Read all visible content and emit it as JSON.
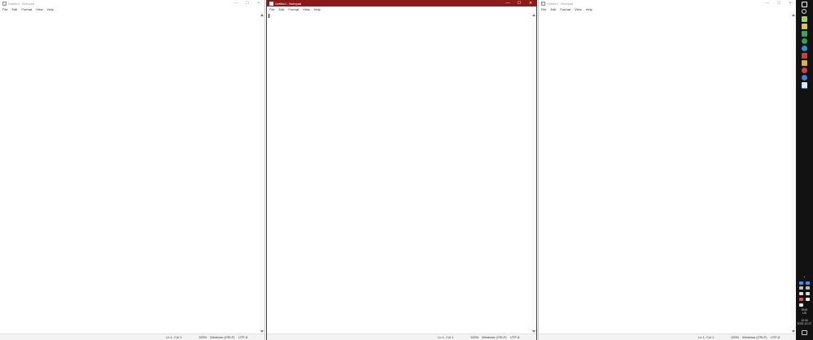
{
  "windows": [
    {
      "title": "Untitled - Notepad",
      "menu": [
        "File",
        "Edit",
        "Format",
        "View",
        "Help"
      ],
      "status": {
        "position": "Ln 1, Col 1",
        "zoom": "100%",
        "line_ending": "Windows (CRLF)",
        "encoding": "UTF-8"
      }
    },
    {
      "title": "Untitled - Notepad",
      "menu": [
        "File",
        "Edit",
        "Format",
        "View",
        "Help"
      ],
      "status": {
        "position": "Ln 1, Col 1",
        "zoom": "100%",
        "line_ending": "Windows (CRLF)",
        "encoding": "UTF-8"
      }
    },
    {
      "title": "Untitled - Notepad",
      "menu": [
        "File",
        "Edit",
        "Format",
        "View",
        "Help"
      ],
      "status": {
        "position": "Ln 1, Col 1",
        "zoom": "100%",
        "line_ending": "Windows (CRLF)",
        "encoding": "UTF-8"
      }
    }
  ],
  "active_window": 1,
  "caption_buttons": {
    "minimize": "—",
    "maximize": "☐",
    "close": "✕"
  },
  "taskbar": {
    "language": "ENG",
    "layout": "US",
    "time": "12:34",
    "date": "2022-12-27"
  },
  "colors": {
    "active_title": "#8b1a1a",
    "taskbar": "#121212"
  }
}
